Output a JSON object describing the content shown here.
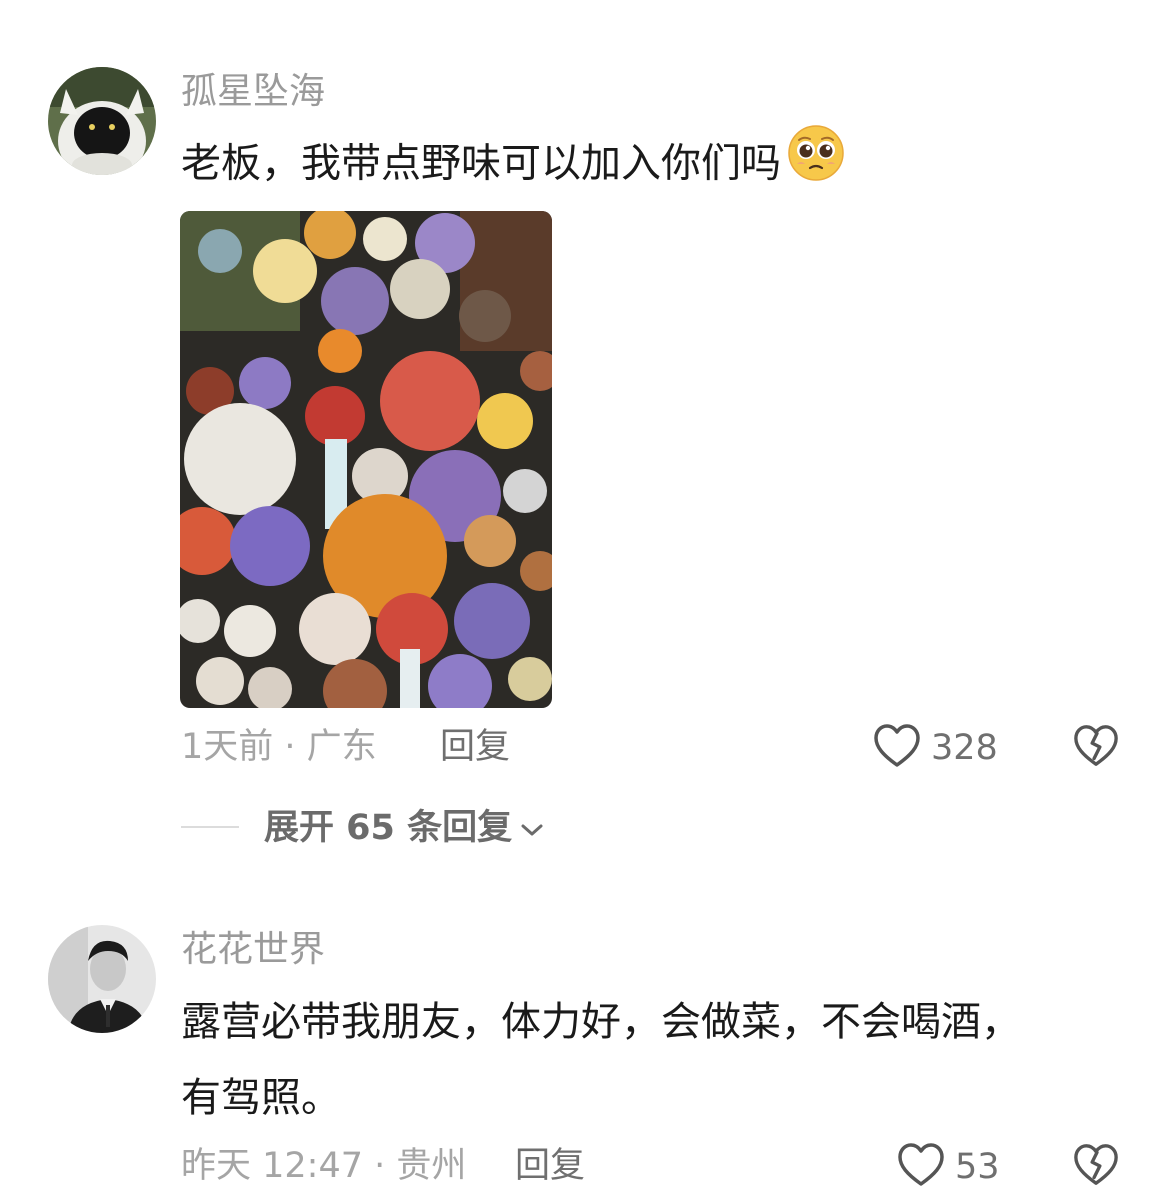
{
  "comments": [
    {
      "username": "孤星坠海",
      "text_line1": "老板，我带点野味可以加入你们吗",
      "emoji": "pleading-face",
      "meta": "1天前 · 广东",
      "reply": "回复",
      "likes": "328",
      "avatar_icon": "cat-avatar",
      "image_alt": "mushroom-photo"
    },
    {
      "username": "花花世界",
      "text_line1": "露营必带我朋友，体力好，会做菜，不会喝酒，",
      "text_line2": "有驾照。",
      "meta": "昨天 12:47 · 贵州",
      "reply": "回复",
      "likes": "53",
      "avatar_icon": "man-avatar"
    }
  ],
  "expand_replies": "展开 65 条回复",
  "icons": {
    "like": "heart-icon",
    "dislike": "broken-heart-icon",
    "expand": "chevron-down-icon"
  },
  "colors": {
    "username": "#9a9a9a",
    "meta": "#a5a5a5",
    "action": "#6f6f6f",
    "text": "#1a1a1a"
  }
}
